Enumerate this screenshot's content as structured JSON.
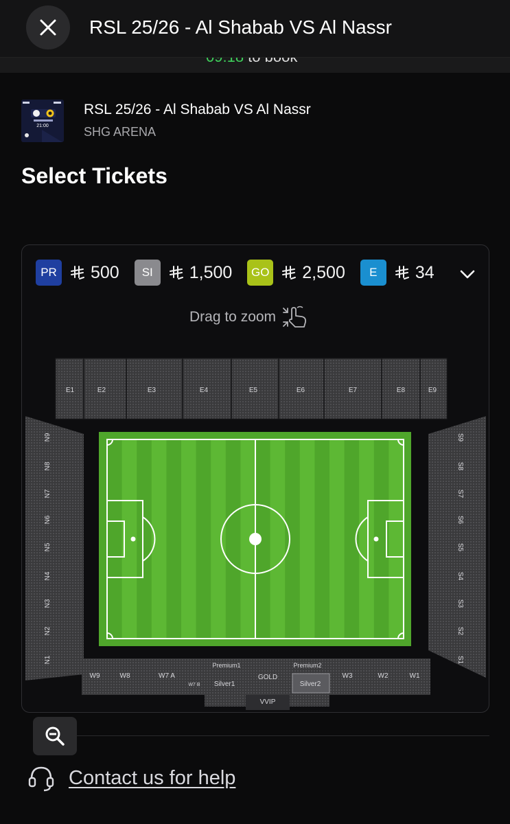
{
  "header": {
    "title": "RSL 25/26 - Al Shabab VS Al Nassr",
    "timer": "09:18",
    "timer_suffix": " to book"
  },
  "event": {
    "title": "RSL 25/26 - Al Shabab VS Al Nassr",
    "venue": "SHG ARENA",
    "thumb_time": "21:00"
  },
  "page": {
    "heading": "Select Tickets"
  },
  "legend": [
    {
      "code": "PR",
      "price": "500",
      "color": "#1f3fa0"
    },
    {
      "code": "SI",
      "price": "1,500",
      "color": "#8a8a8e"
    },
    {
      "code": "GO",
      "price": "2,500",
      "color": "#a9c219"
    },
    {
      "code": "E",
      "price": "34",
      "color": "#1a8fd0"
    }
  ],
  "map": {
    "drag_hint": "Drag to zoom",
    "east_sections": [
      "E1",
      "E2",
      "E3",
      "E4",
      "E5",
      "E6",
      "E7",
      "E8",
      "E9"
    ],
    "north_sections": [
      "N9",
      "N8",
      "N7",
      "N6",
      "N5",
      "N4",
      "N3",
      "N2",
      "N1"
    ],
    "south_sections": [
      "S9",
      "S8",
      "S7",
      "S6",
      "S5",
      "S4",
      "S3",
      "S2",
      "S1"
    ],
    "west_sections": [
      "W9",
      "W8",
      "W7 A",
      "W7 B",
      "Premium1",
      "Silver1",
      "GOLD",
      "Premium2",
      "Silver2",
      "W3",
      "W2",
      "W1",
      "VVIP"
    ],
    "pitch_color": "#4fa62b",
    "pitch_stripe_color": "#5db834",
    "section_color": "#3a3a3c"
  },
  "footer": {
    "help_label": "Contact us for help"
  }
}
